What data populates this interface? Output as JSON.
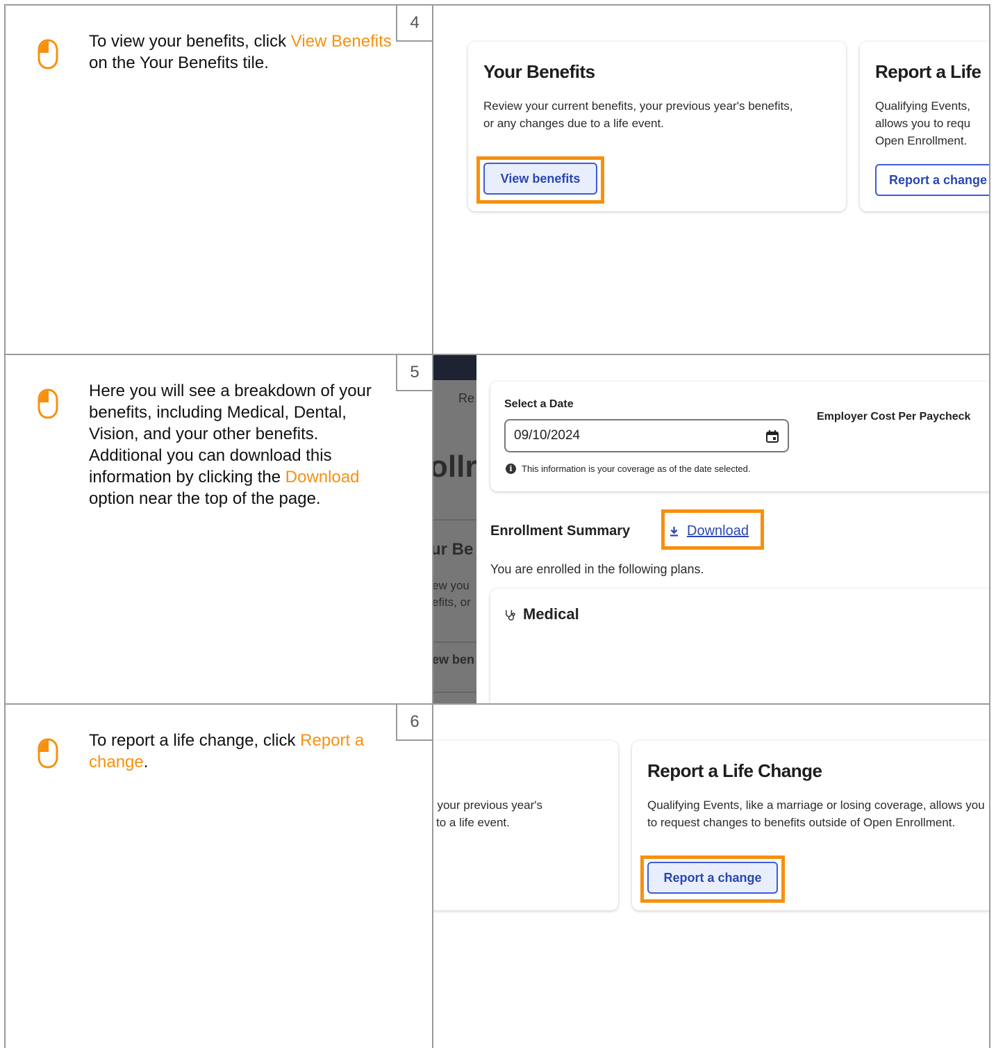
{
  "steps": [
    {
      "number": "4",
      "instruction": {
        "before": "To view your benefits, click ",
        "highlight": "View Benefits",
        "after": " on the Your Benefits tile."
      },
      "cards": {
        "your_benefits": {
          "title": "Your Benefits",
          "text": "Review your current benefits, your previous year's benefits, or any changes due to a life event.",
          "button": "View benefits"
        },
        "report_life_partial": {
          "title": "Report a Life",
          "text_lines": [
            "Qualifying Events,",
            "allows you to requ",
            "Open Enrollment."
          ],
          "button": "Report a change"
        }
      }
    },
    {
      "number": "5",
      "instruction": {
        "before": "Here you will see a breakdown of your benefits, including Medical, Dental, Vision, and your other benefits. Additional you can download this information by clicking the ",
        "highlight": "Download",
        "after": " option near the top of the page."
      },
      "background_fragments": {
        "re": "Re",
        "ollr": "ollr",
        "ur_be": "ur Be",
        "ew_you": "ew you",
        "efits_or": "efits, or",
        "ew_ben": "ew ben"
      },
      "date_card": {
        "label": "Select a Date",
        "date_value": "09/10/2024",
        "note": "This information is your coverage as of the date selected.",
        "employer_cost_label": "Employer Cost Per Paycheck"
      },
      "enrollment": {
        "title": "Enrollment Summary",
        "download": "Download",
        "subtitle": "You are enrolled in the following plans.",
        "medical": "Medical"
      }
    },
    {
      "number": "6",
      "instruction": {
        "before": "To report a life change, click ",
        "highlight": "Report a change",
        "after": "."
      },
      "cards": {
        "partial_left": {
          "line1": ", your previous year's",
          "line2": "to a life event."
        },
        "report_life_change": {
          "title": "Report a Life Change",
          "text": "Qualifying Events, like a marriage or losing coverage, allows you to request changes to benefits outside of Open Enrollment.",
          "button": "Report a change"
        }
      }
    }
  ],
  "colors": {
    "highlight": "#f7900e",
    "button_blue": "#2a46b3",
    "border_gray": "#9a9a9a"
  }
}
